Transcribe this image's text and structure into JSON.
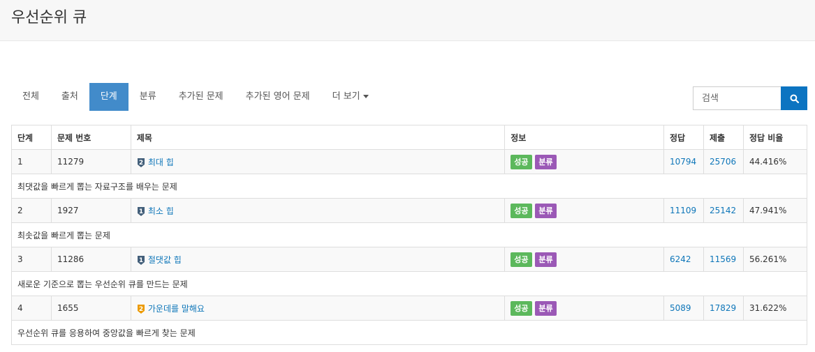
{
  "header": {
    "title": "우선순위 큐"
  },
  "tabs": [
    {
      "label": "전체",
      "active": false
    },
    {
      "label": "출처",
      "active": false
    },
    {
      "label": "단계",
      "active": true
    },
    {
      "label": "분류",
      "active": false
    },
    {
      "label": "추가된 문제",
      "active": false
    },
    {
      "label": "추가된 영어 문제",
      "active": false
    },
    {
      "label": "더 보기",
      "active": false
    }
  ],
  "search": {
    "placeholder": "검색"
  },
  "table": {
    "columns": [
      "단계",
      "문제 번호",
      "제목",
      "정보",
      "정답",
      "제출",
      "정답 비율"
    ],
    "rows": [
      {
        "step": "1",
        "id": "11279",
        "tier": "2",
        "tier_color": "#435f7a",
        "title": "최대 힙",
        "badge_success": "성공",
        "badge_category": "분류",
        "solved": "10794",
        "submitted": "25706",
        "ratio": "44.416%",
        "description": "최댓값을 빠르게 뽑는 자료구조를 배우는 문제"
      },
      {
        "step": "2",
        "id": "1927",
        "tier": "1",
        "tier_color": "#435f7a",
        "title": "최소 힙",
        "badge_success": "성공",
        "badge_category": "분류",
        "solved": "11109",
        "submitted": "25142",
        "ratio": "47.941%",
        "description": "최솟값을 빠르게 뽑는 문제"
      },
      {
        "step": "3",
        "id": "11286",
        "tier": "1",
        "tier_color": "#435f7a",
        "title": "절댓값 힙",
        "badge_success": "성공",
        "badge_category": "분류",
        "solved": "6242",
        "submitted": "11569",
        "ratio": "56.261%",
        "description": "새로운 기준으로 뽑는 우선순위 큐를 만드는 문제"
      },
      {
        "step": "4",
        "id": "1655",
        "tier": "2",
        "tier_color": "#ec9a00",
        "title": "가운데를 말해요",
        "badge_success": "성공",
        "badge_category": "분류",
        "solved": "5089",
        "submitted": "17829",
        "ratio": "31.622%",
        "description": "우선순위 큐를 응용하여 중앙값을 빠르게 찾는 문제"
      }
    ]
  },
  "colors": {
    "accent": "#428bca",
    "search_button": "#0c74c1",
    "link": "#0e76b9",
    "success": "#5cb85c",
    "category": "#9b59b6"
  }
}
